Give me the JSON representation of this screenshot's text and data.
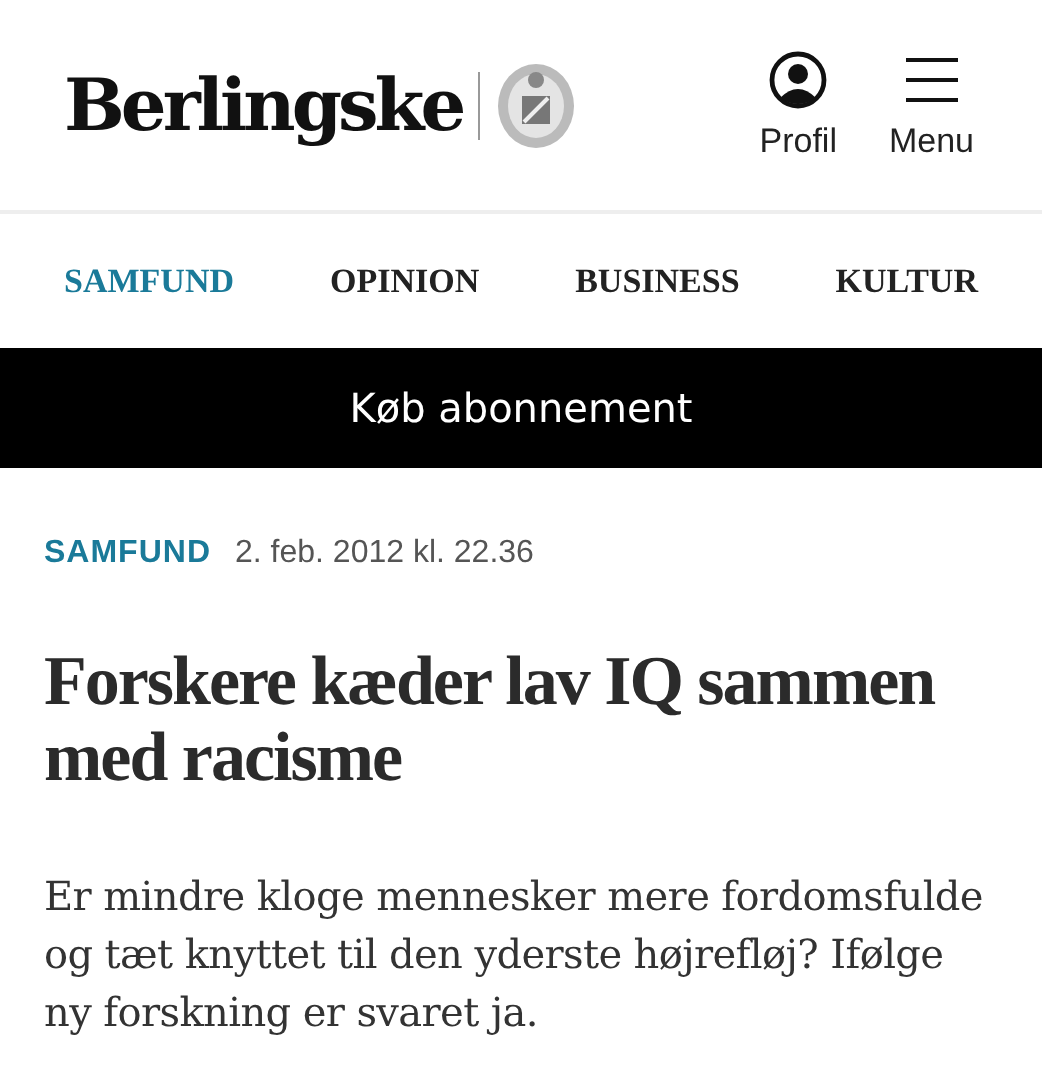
{
  "header": {
    "logo": "Berlingske",
    "actions": [
      {
        "kind": "profile",
        "label": "Profil"
      },
      {
        "kind": "menu",
        "label": "Menu"
      }
    ]
  },
  "nav": [
    {
      "label": "SAMFUND",
      "selected": true
    },
    {
      "label": "OPINION",
      "selected": false
    },
    {
      "label": "BUSINESS",
      "selected": false
    },
    {
      "label": "KULTUR",
      "selected": false
    }
  ],
  "subscribe_button": "Køb abonnement",
  "article": {
    "section": "SAMFUND",
    "date": "2. feb. 2012 kl. 22.36",
    "title": "Forskere kæder lav IQ sammen med racisme",
    "lead": "Er mindre kloge mennesker mere fordomsfulde og tæt knyttet til den yderste højrefløj? Ifølge ny forskning er svaret ja."
  }
}
